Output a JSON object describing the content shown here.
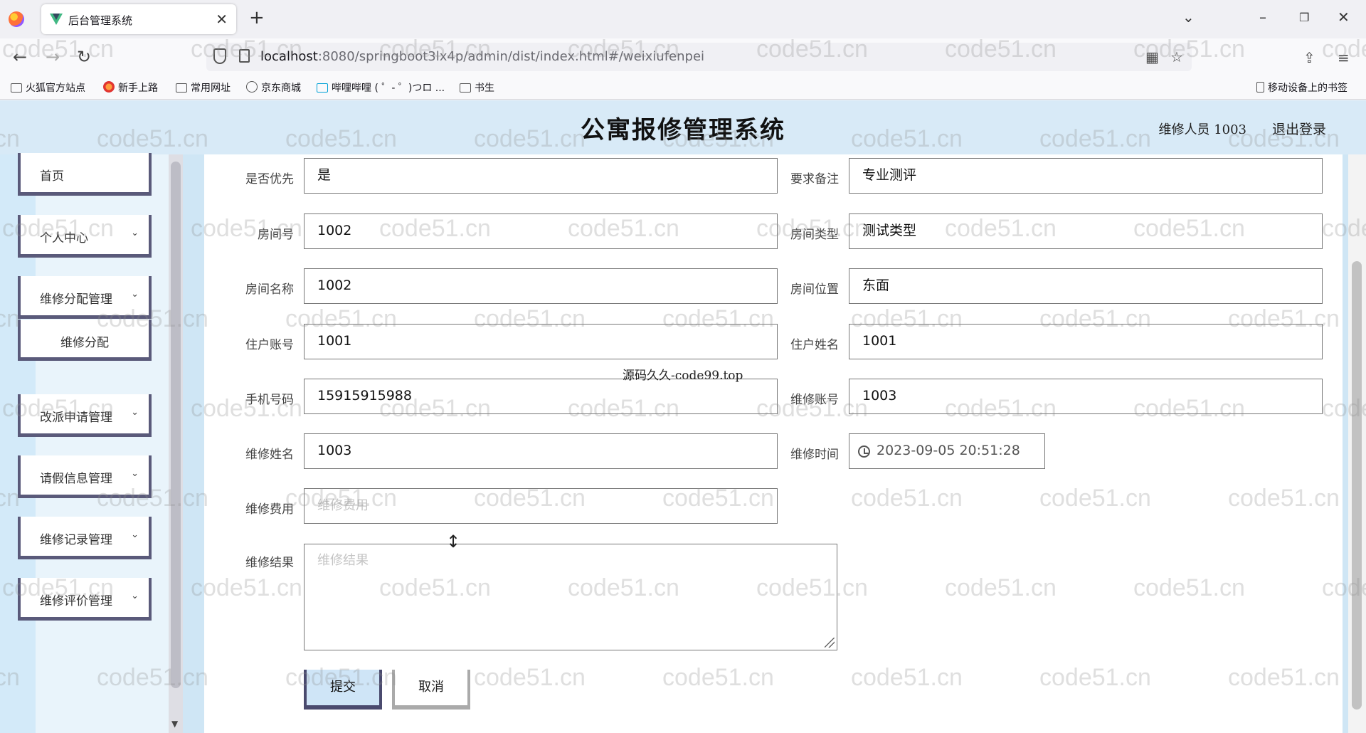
{
  "browser": {
    "tab_title": "后台管理系统",
    "tab_close": "✕",
    "new_tab": "+",
    "url_host": "localhost",
    "url_rest": ":8080/springboot3lx4p/admin/dist/index.html#/weixiufenpei",
    "bookmarks": [
      "火狐官方站点",
      "新手上路",
      "常用网址",
      "京东商城",
      "哔哩哔哩 ( ゜- ゜)つロ ...",
      "书生"
    ],
    "mobile_bookmarks": "移动设备上的书签"
  },
  "app": {
    "title": "公寓报修管理系统",
    "user_info": "维修人员 1003",
    "logout": "退出登录"
  },
  "sidebar": {
    "items": [
      {
        "label": "首页",
        "chevron": ""
      },
      {
        "label": "个人中心",
        "chevron": "⌄"
      },
      {
        "label": "维修分配管理",
        "chevron": "⌄"
      },
      {
        "label": "维修分配",
        "chevron": ""
      },
      {
        "label": "改派申请管理",
        "chevron": "⌄"
      },
      {
        "label": "请假信息管理",
        "chevron": "⌄"
      },
      {
        "label": "维修记录管理",
        "chevron": "⌄"
      },
      {
        "label": "维修评价管理",
        "chevron": "⌄"
      }
    ]
  },
  "form": {
    "fields": {
      "priority": {
        "label": "是否优先",
        "value": "是"
      },
      "remark": {
        "label": "要求备注",
        "value": "专业测评"
      },
      "room_no": {
        "label": "房间号",
        "value": "1002"
      },
      "room_type": {
        "label": "房间类型",
        "value": "测试类型"
      },
      "room_name": {
        "label": "房间名称",
        "value": "1002"
      },
      "room_location": {
        "label": "房间位置",
        "value": "东面"
      },
      "resident_account": {
        "label": "住户账号",
        "value": "1001"
      },
      "resident_name": {
        "label": "住户姓名",
        "value": "1001"
      },
      "phone": {
        "label": "手机号码",
        "value": "15915915988"
      },
      "repair_account": {
        "label": "维修账号",
        "value": "1003"
      },
      "repair_name": {
        "label": "维修姓名",
        "value": "1003"
      },
      "repair_time": {
        "label": "维修时间",
        "value": "2023-09-05 20:51:28"
      },
      "repair_fee": {
        "label": "维修费用",
        "placeholder": "维修费用"
      },
      "repair_result": {
        "label": "维修结果",
        "placeholder": "维修结果"
      }
    },
    "submit": "提交",
    "cancel": "取消"
  },
  "overlay": "源码久久-code99.top",
  "watermark": "code51.cn"
}
